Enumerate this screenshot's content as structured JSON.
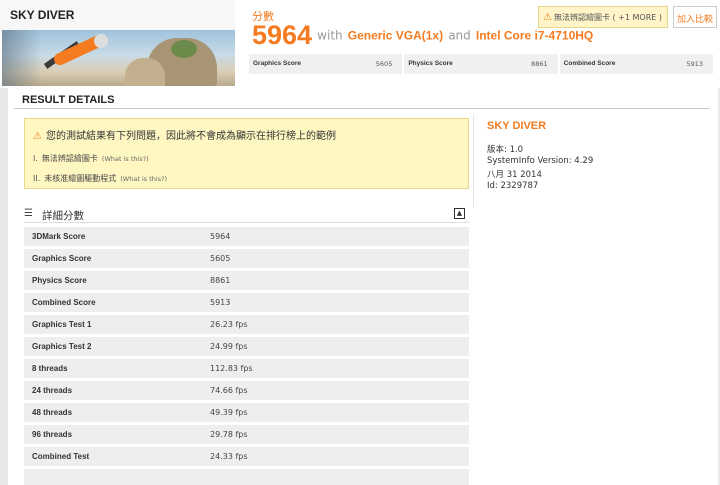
{
  "header": {
    "benchmark_name": "SKY DIVER",
    "score_label": "分數",
    "score_value": "5964",
    "with_text": "with",
    "gpu": "Generic VGA(1x)",
    "and_text": "and",
    "cpu": "Intel Core i7-4710HQ",
    "warning_badge": "無法辨認繪圖卡",
    "warning_more": "( +1 MORE )",
    "compare_button": "加入比較",
    "sub_scores": [
      {
        "label": "Graphics Score",
        "value": "5605"
      },
      {
        "label": "Physics Score",
        "value": "8861"
      },
      {
        "label": "Combined Score",
        "value": "5913"
      }
    ]
  },
  "main": {
    "title": "RESULT DETAILS",
    "warning": {
      "headline": "您的測試結果有下列問題，因此將不會成為顯示在排行榜上的範例",
      "items": [
        {
          "num": "I.",
          "text": "無法辨認繪圖卡",
          "link": "(What is this?)"
        },
        {
          "num": "II.",
          "text": "未核准繪圖驅動程式",
          "link": "(What is this?)"
        }
      ]
    },
    "details_label": "詳細分數",
    "toggle_symbol": "▲",
    "rows": [
      {
        "label": "3DMark Score",
        "value": "5964"
      },
      {
        "label": "Graphics Score",
        "value": "5605"
      },
      {
        "label": "Physics Score",
        "value": "8861"
      },
      {
        "label": "Combined Score",
        "value": "5913"
      },
      {
        "label": "Graphics Test 1",
        "value": "26.23 fps"
      },
      {
        "label": "Graphics Test 2",
        "value": "24.99 fps"
      },
      {
        "label": "8 threads",
        "value": "112.83 fps"
      },
      {
        "label": "24 threads",
        "value": "74.66 fps"
      },
      {
        "label": "48 threads",
        "value": "49.39 fps"
      },
      {
        "label": "96 threads",
        "value": "29.78 fps"
      },
      {
        "label": "Combined Test",
        "value": "24.33 fps"
      },
      {
        "label": "",
        "value": ""
      }
    ]
  },
  "side": {
    "title": "SKY DIVER",
    "version": "版本: 1.0",
    "systeminfo": "SystemInfo Version: 4.29",
    "date": "八月 31 2014",
    "id": "Id: 2329787"
  },
  "colors": {
    "accent": "#f47b20",
    "warning_bg": "#fff7c2",
    "row_bg": "#eeeeee"
  },
  "icons": [
    "warning-icon",
    "menu-icon",
    "collapse-icon"
  ]
}
